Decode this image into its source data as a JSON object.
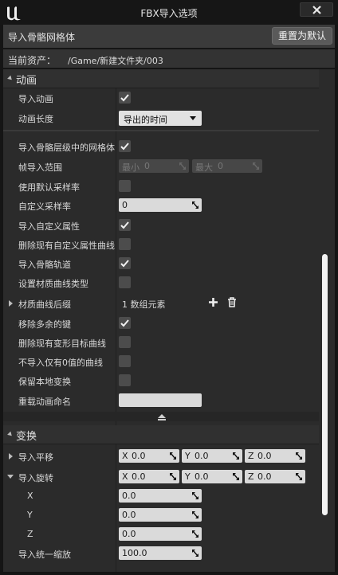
{
  "window": {
    "title": "FBX导入选项"
  },
  "header": {
    "title": "导入骨骼网格体",
    "reset_label": "重置为默认"
  },
  "asset": {
    "label": "当前资产：",
    "value": "/Game/新建文件夹/003"
  },
  "sections": {
    "animation": {
      "title": "动画",
      "import_animation": {
        "label": "导入动画",
        "checked": true
      },
      "animation_length": {
        "label": "动画长度",
        "value": "导出的时间"
      },
      "import_meshes_in_bone_hierarchy": {
        "label": "导入骨骼层级中的网格体",
        "checked": true
      },
      "frame_import_range": {
        "label": "帧导入范围",
        "min_prefix": "最小",
        "min_value": "0",
        "max_prefix": "最大",
        "max_value": "0"
      },
      "use_default_sample_rate": {
        "label": "使用默认采样率",
        "checked": false
      },
      "custom_sample_rate": {
        "label": "自定义采样率",
        "value": "0"
      },
      "import_custom_attribute": {
        "label": "导入自定义属性",
        "checked": true
      },
      "delete_existing_custom_attribute_curves": {
        "label": "删除现有自定义属性曲线",
        "checked": false
      },
      "import_bone_tracks": {
        "label": "导入骨骼轨道",
        "checked": true
      },
      "set_material_curve_type": {
        "label": "设置材质曲线类型",
        "checked": false
      },
      "material_curve_suffixes": {
        "label": "材质曲线后缀",
        "count_text": "1 数组元素"
      },
      "remove_redundant_keys": {
        "label": "移除多余的键",
        "checked": true
      },
      "delete_existing_morph_target_curves": {
        "label": "删除现有变形目标曲线",
        "checked": false
      },
      "do_not_import_curve_with_zero_values": {
        "label": "不导入仅有0值的曲线",
        "checked": false
      },
      "preserve_local_transform": {
        "label": "保留本地变换",
        "checked": false
      },
      "override_animation_name": {
        "label": "重载动画命名",
        "value": ""
      }
    },
    "transform": {
      "title": "变换",
      "import_translation": {
        "label": "导入平移",
        "x_label": "X",
        "x": "0.0",
        "y_label": "Y",
        "y": "0.0",
        "z_label": "Z",
        "z": "0.0"
      },
      "import_rotation": {
        "label": "导入旋转",
        "x_label": "X",
        "x": "0.0",
        "y_label": "Y",
        "y": "0.0",
        "z_label": "Z",
        "z": "0.0",
        "sub": {
          "x_label": "X",
          "x": "0.0",
          "y_label": "Y",
          "y": "0.0",
          "z_label": "Z",
          "z": "0.0"
        }
      },
      "import_uniform_scale": {
        "label": "导入统一缩放",
        "value": "100.0"
      }
    }
  },
  "icons": [
    "unreal-logo-icon",
    "close-icon",
    "checkmark-icon",
    "dropdown-caret-icon",
    "spin-grip-icon",
    "plus-icon",
    "trash-icon",
    "collapse-arrow-icon"
  ],
  "colors": {
    "background": "#151515",
    "panel": "#2b2b2b",
    "header": "#3b3b3b",
    "field": "#dadada",
    "scrollbar": "#f2f2f2"
  }
}
